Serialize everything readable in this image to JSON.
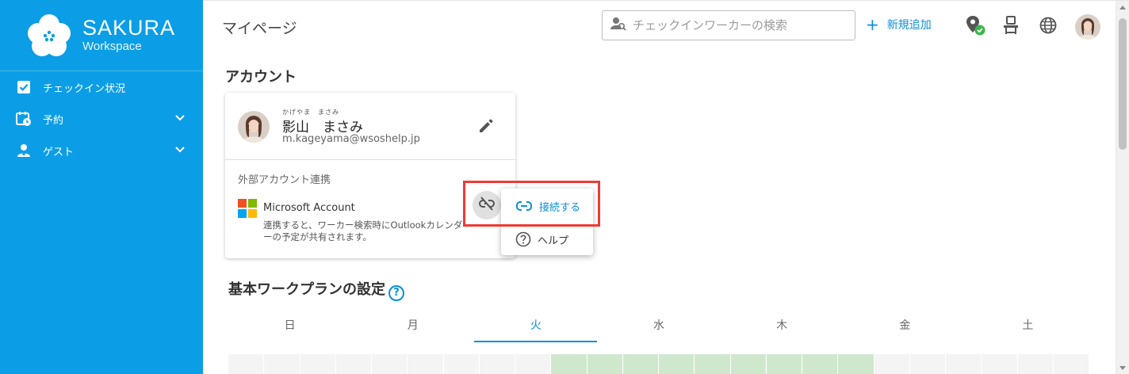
{
  "app": {
    "brand_name": "SAKURA",
    "brand_sub": "Workspace"
  },
  "sidebar": {
    "items": [
      {
        "label": "チェックイン状況",
        "icon": "checkbox-icon",
        "expandable": false
      },
      {
        "label": "予約",
        "icon": "calendar-clock-icon",
        "expandable": true
      },
      {
        "label": "ゲスト",
        "icon": "guest-icon",
        "expandable": true
      }
    ]
  },
  "header": {
    "page_title": "マイページ",
    "search_placeholder": "チェックインワーカーの検索",
    "add_label": "新規追加",
    "icons": [
      "location-check-icon",
      "checkin-desk-icon",
      "globe-icon",
      "user-avatar"
    ]
  },
  "account": {
    "section_title": "アカウント",
    "name_ruby": "かげやま　まさみ",
    "name": "影山　まさみ",
    "email": "m.kageyama@wsoshelp.jp",
    "external_title": "外部アカウント連携",
    "ms_account": "Microsoft Account",
    "ms_desc": "連携すると、ワーカー検索時にOutlookカレンダーの予定が共有されます。"
  },
  "menu": {
    "connect_label": "接続する",
    "help_label": "ヘルプ"
  },
  "workplan": {
    "section_title": "基本ワークプランの設定",
    "days": [
      "日",
      "月",
      "火",
      "水",
      "木",
      "金",
      "土"
    ],
    "active_day": "火"
  },
  "colors": {
    "sidebar": "#0b9ee6",
    "accent": "#0b8fd8",
    "highlight": "#ee3b33",
    "plan_fill": "#cfe8cd"
  }
}
